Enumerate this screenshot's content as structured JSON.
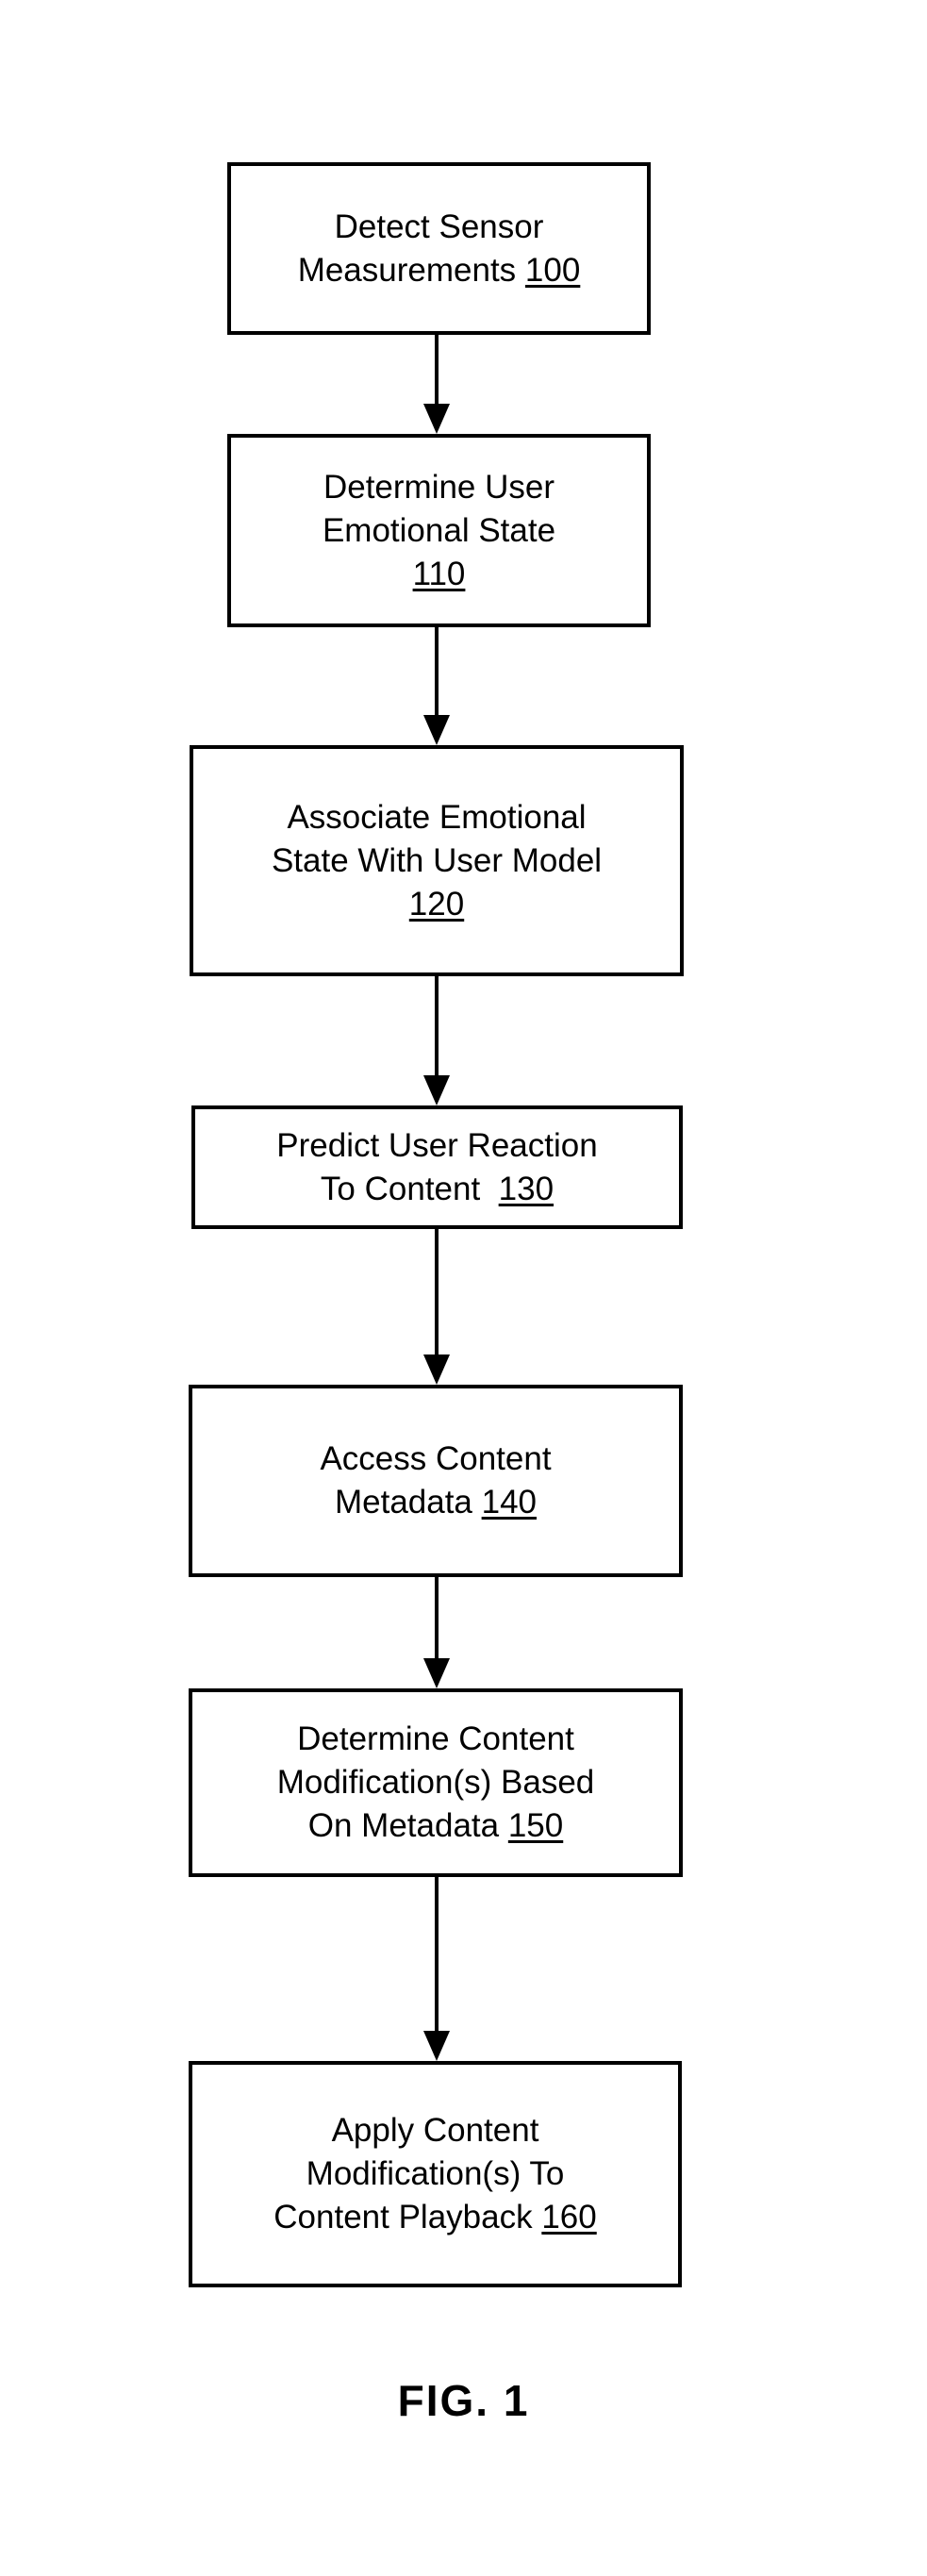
{
  "figure": {
    "caption": "FIG. 1",
    "type": "flowchart",
    "orientation": "vertical-top-to-bottom"
  },
  "flowchart": {
    "steps": [
      {
        "id": "detect-sensor-measurements",
        "line1": "Detect Sensor",
        "line2": "Measurements ",
        "ref": "100",
        "full_text": "Detect Sensor Measurements 100"
      },
      {
        "id": "determine-user-emotional-state",
        "line1": "Determine User",
        "line2": "Emotional State",
        "line3": "",
        "ref": "110",
        "full_text": "Determine User Emotional State 110"
      },
      {
        "id": "associate-emotional-state-with-user-model",
        "line1": "Associate Emotional",
        "line2": "State With User Model",
        "line3": "",
        "ref": "120",
        "full_text": "Associate Emotional State With User Model 120"
      },
      {
        "id": "predict-user-reaction-to-content",
        "line1": "Predict User Reaction",
        "line2": "To Content  ",
        "ref": "130",
        "full_text": "Predict User Reaction To Content 130"
      },
      {
        "id": "access-content-metadata",
        "line1": "Access Content",
        "line2": "Metadata ",
        "ref": "140",
        "full_text": "Access Content Metadata 140"
      },
      {
        "id": "determine-content-modifications-based-on-metadata",
        "line1": "Determine Content",
        "line2": "Modification(s) Based",
        "line3": "On Metadata ",
        "ref": "150",
        "full_text": "Determine Content Modification(s) Based On Metadata 150"
      },
      {
        "id": "apply-content-modifications-to-content-playback",
        "line1": "Apply Content",
        "line2": "Modification(s) To",
        "line3": "Content Playback ",
        "ref": "160",
        "full_text": "Apply Content Modification(s) To Content Playback 160"
      }
    ],
    "connectors": [
      {
        "id": "arrow-100-to-110",
        "from": "100",
        "to": "110"
      },
      {
        "id": "arrow-110-to-120",
        "from": "110",
        "to": "120"
      },
      {
        "id": "arrow-120-to-130",
        "from": "120",
        "to": "130"
      },
      {
        "id": "arrow-130-to-140",
        "from": "130",
        "to": "140"
      },
      {
        "id": "arrow-140-to-150",
        "from": "140",
        "to": "150"
      },
      {
        "id": "arrow-150-to-160",
        "from": "150",
        "to": "160"
      }
    ]
  },
  "colors": {
    "stroke": "#000000",
    "background": "#ffffff",
    "text": "#000000"
  }
}
